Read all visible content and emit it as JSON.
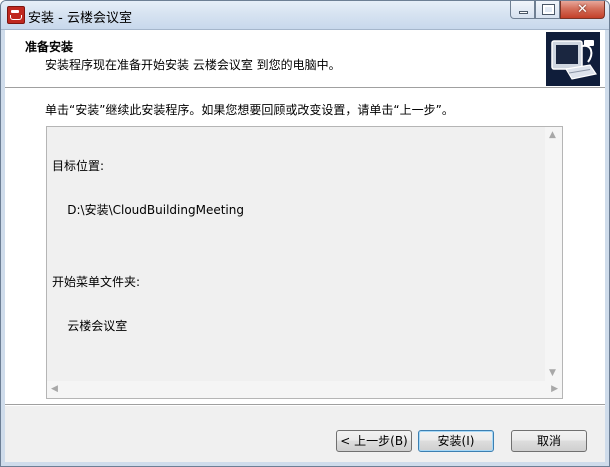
{
  "window": {
    "title": "安装 - 云楼会议室",
    "close_glyph": "✕"
  },
  "header": {
    "title": "准备安装",
    "subtitle": "安装程序现在准备开始安装 云楼会议室 到您的电脑中。"
  },
  "body": {
    "instruction": "单击“安装”继续此安装程序。如果您想要回顾或改变设置，请单击“上一步”。",
    "memo_lines": [
      "目标位置:",
      "    D:\\安装\\CloudBuildingMeeting",
      "",
      "开始菜单文件夹:",
      "    云楼会议室"
    ]
  },
  "buttons": {
    "back": "< 上一步(B)",
    "install": "安装(I)",
    "cancel": "取消"
  },
  "colors": {
    "close_button": "#c4402a",
    "header_image_bg": "#0f1d3a",
    "default_button_border": "#3c7fb1"
  },
  "icons": {
    "app": "app-logo-icon",
    "header": "computer-install-icon"
  }
}
